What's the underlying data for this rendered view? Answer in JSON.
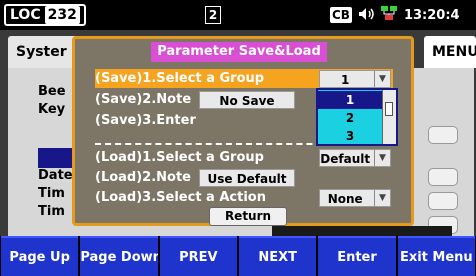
{
  "statusbar": {
    "loc_label": "LOC",
    "loc_address": "232",
    "slot_label": "2",
    "cb_label": "CB",
    "time": "13:20:4"
  },
  "background": {
    "tab_system": "Syster",
    "tab_menu": "MENU",
    "items": [
      "Bee",
      "Key",
      "Date",
      "Tim",
      "Tim"
    ]
  },
  "dialog": {
    "title": "Parameter Save&Load",
    "rows": {
      "save_group": "(Save)1.Select a Group",
      "save_note": "(Save)2.Note",
      "save_enter": "(Save)3.Enter",
      "load_group": "(Load)1.Select a Group",
      "load_note": "(Load)2.Note",
      "load_action": "(Load)3.Select a Action"
    },
    "save_group_value": "1",
    "save_note_value": "No Save",
    "load_group_value": "Default",
    "load_note_value": "Use Default",
    "load_action_value": "None",
    "return_label": "Return",
    "dropdown_options": [
      "1",
      "2",
      "3"
    ],
    "dropdown_selected": "1"
  },
  "softkeys": [
    "Page Up",
    "Page Down",
    "PREV",
    "NEXT",
    "Enter",
    "Exit Menu"
  ],
  "colors": {
    "dialog_border": "#e59a1c",
    "title_bg": "#d84fd3",
    "highlight": "#f6a31f",
    "softkey_bg": "#1f34cc",
    "dropdown_bg": "#1bd0e0"
  }
}
